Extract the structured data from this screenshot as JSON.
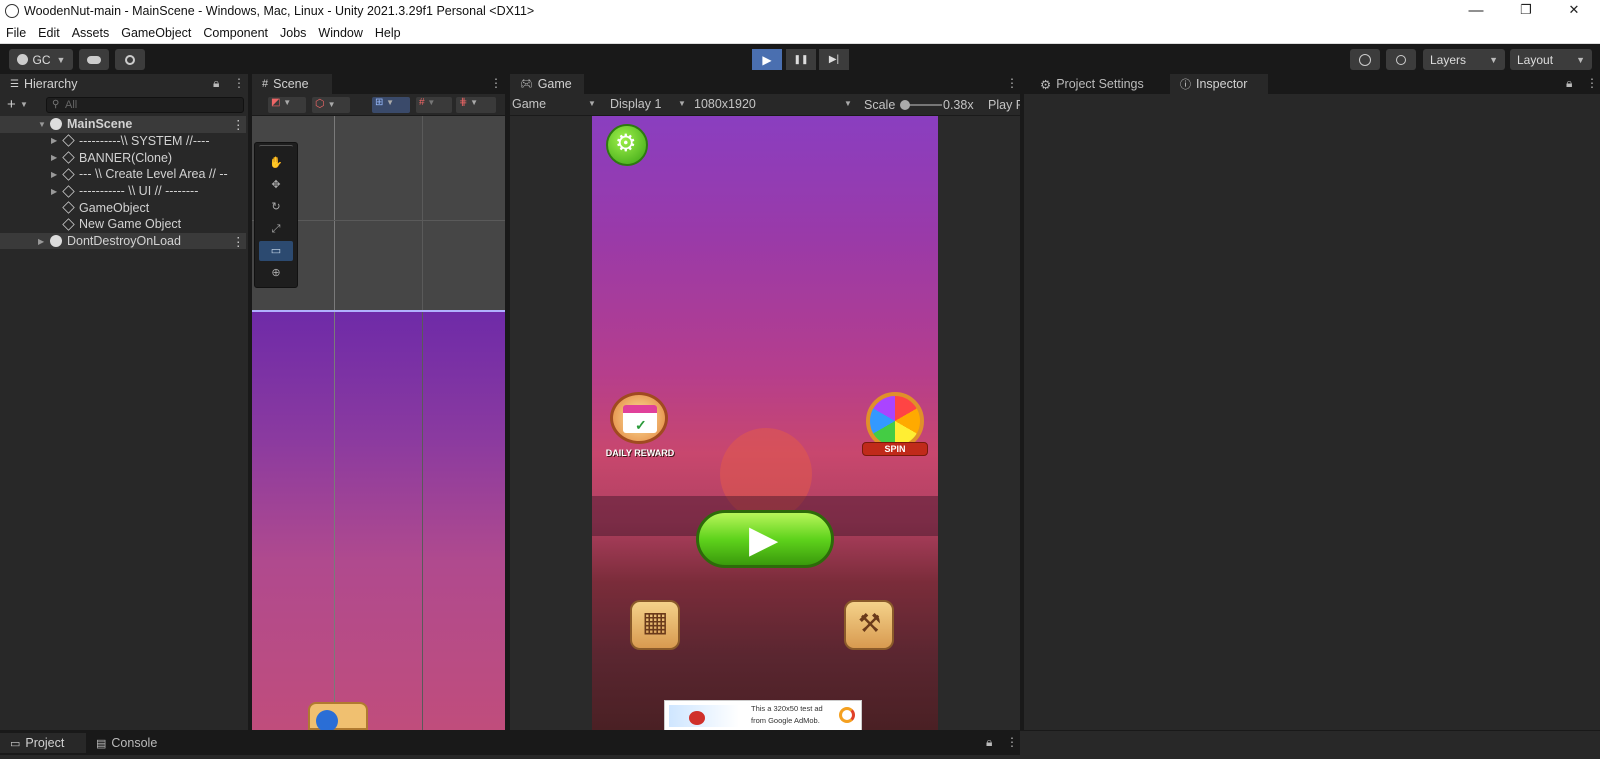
{
  "window": {
    "title": "WoodenNut-main - MainScene - Windows, Mac, Linux - Unity 2021.3.29f1 Personal <DX11>",
    "minimize": "—",
    "restore": "❐",
    "close": "✕"
  },
  "menu": [
    "File",
    "Edit",
    "Assets",
    "GameObject",
    "Component",
    "Jobs",
    "Window",
    "Help"
  ],
  "toolbar": {
    "account": "GC",
    "cloud_icon": "cloud-icon",
    "collab_icon": "collab-icon",
    "play_icon": "▶",
    "pause_icon": "❚❚",
    "step_icon": "▶|",
    "history_icon": "history-icon",
    "search_icon": "search-icon",
    "layers": "Layers",
    "layout": "Layout"
  },
  "hierarchy": {
    "tab": "Hierarchy",
    "search_placeholder": "All",
    "items": [
      {
        "label": "MainScene",
        "indent": 0,
        "type": "scene",
        "fold": "▼"
      },
      {
        "label": "----------\\\\ SYSTEM //----",
        "indent": 1,
        "type": "object",
        "fold": "▶"
      },
      {
        "label": "BANNER(Clone)",
        "indent": 1,
        "type": "object",
        "fold": "▶"
      },
      {
        "label": "--- \\\\ Create Level Area // --",
        "indent": 1,
        "type": "object",
        "fold": "▶"
      },
      {
        "label": "----------- \\\\ UI // --------",
        "indent": 1,
        "type": "object",
        "fold": "▶"
      },
      {
        "label": "GameObject",
        "indent": 1,
        "type": "object",
        "fold": ""
      },
      {
        "label": "New Game Object",
        "indent": 1,
        "type": "object",
        "fold": ""
      },
      {
        "label": "DontDestroyOnLoad",
        "indent": 0,
        "type": "scene",
        "fold": "▶"
      }
    ]
  },
  "scene": {
    "tab": "Scene"
  },
  "game": {
    "tab": "Game",
    "mode": "Game",
    "display": "Display 1",
    "resolution": "1080x1920",
    "scale_label": "Scale",
    "scale_value": "0.38x",
    "play_focused": "Play F",
    "daily_reward": "DAILY REWARD",
    "spin": "SPIN",
    "ad_text_1": "This a 320x50 test ad",
    "ad_text_2": "from Google AdMob."
  },
  "right_panel": {
    "tab_project_settings": "Project Settings",
    "tab_inspector": "Inspector"
  },
  "bottom": {
    "tab_project": "Project",
    "tab_console": "Console"
  },
  "colors": {
    "accent_play": "#4a6fb0",
    "sky_top": "#7a2fa0",
    "sky_mid": "#c8477a",
    "play_green": "#5fd31c"
  }
}
